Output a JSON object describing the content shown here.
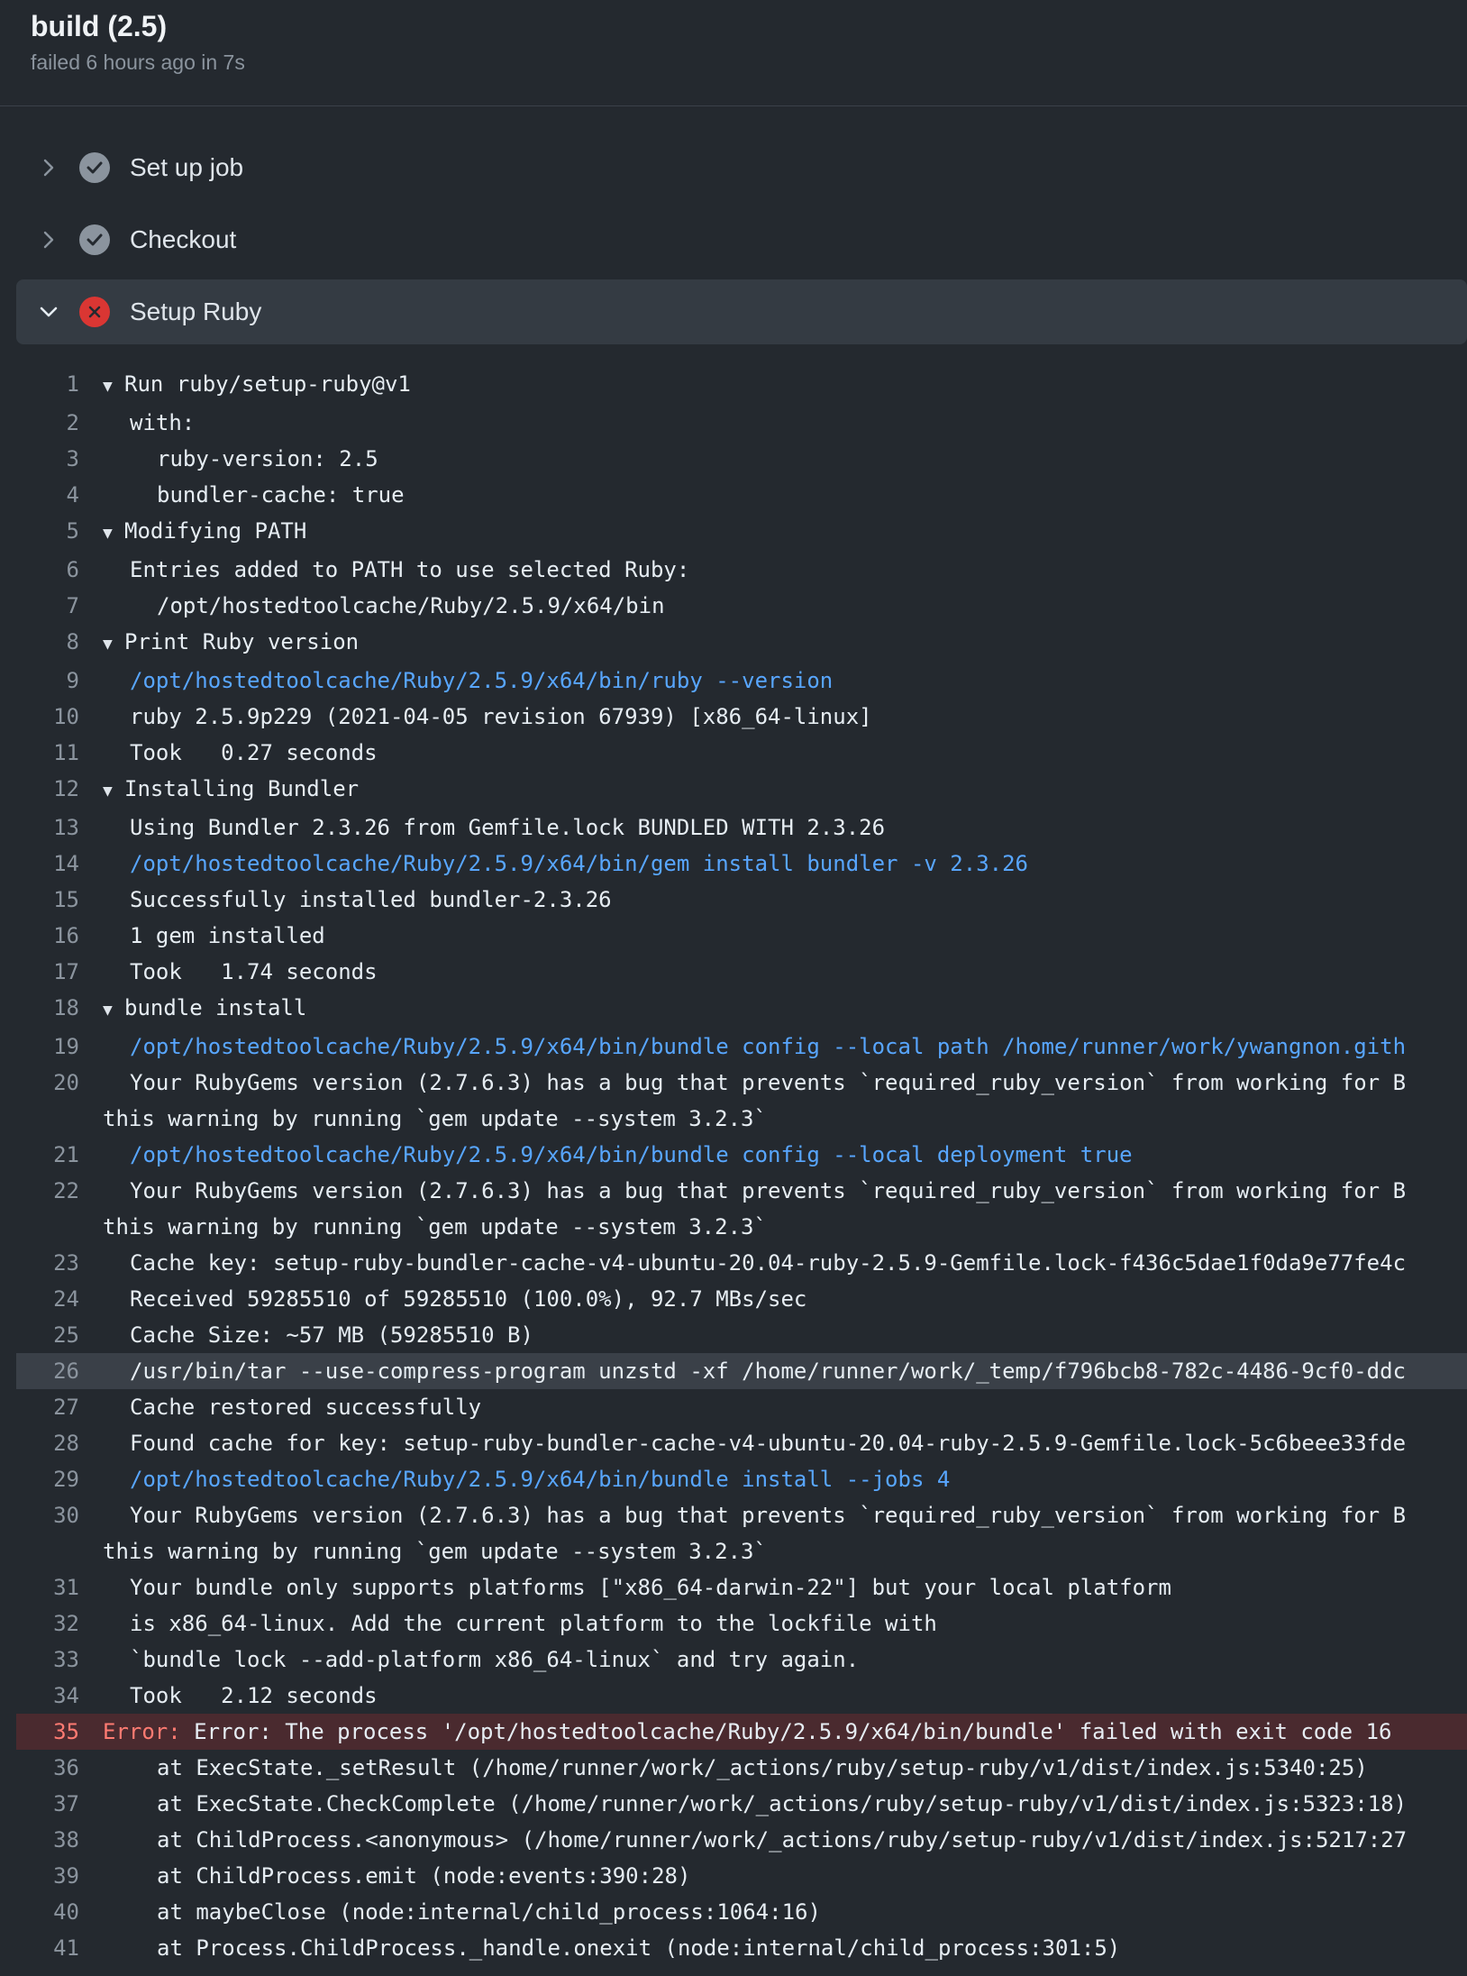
{
  "job": {
    "title": "build (2.5)",
    "subtitle": "failed 6 hours ago in 7s"
  },
  "steps": [
    {
      "label": "Set up job",
      "status": "success",
      "expanded": false
    },
    {
      "label": "Checkout",
      "status": "success",
      "expanded": false
    },
    {
      "label": "Setup Ruby",
      "status": "failure",
      "expanded": true
    }
  ],
  "log": [
    {
      "n": "1",
      "text": "Run ruby/setup-ruby@v1",
      "type": "group"
    },
    {
      "n": "2",
      "text": "with:",
      "type": "i1"
    },
    {
      "n": "3",
      "text": "ruby-version: 2.5",
      "type": "i2"
    },
    {
      "n": "4",
      "text": "bundler-cache: true",
      "type": "i2"
    },
    {
      "n": "5",
      "text": "Modifying PATH",
      "type": "group"
    },
    {
      "n": "6",
      "text": "Entries added to PATH to use selected Ruby:",
      "type": "i1"
    },
    {
      "n": "7",
      "text": "/opt/hostedtoolcache/Ruby/2.5.9/x64/bin",
      "type": "i2"
    },
    {
      "n": "8",
      "text": "Print Ruby version",
      "type": "group"
    },
    {
      "n": "9",
      "text": "/opt/hostedtoolcache/Ruby/2.5.9/x64/bin/ruby --version",
      "type": "cmd"
    },
    {
      "n": "10",
      "text": "ruby 2.5.9p229 (2021-04-05 revision 67939) [x86_64-linux]",
      "type": "i1"
    },
    {
      "n": "11",
      "text": "Took   0.27 seconds",
      "type": "i1"
    },
    {
      "n": "12",
      "text": "Installing Bundler",
      "type": "group"
    },
    {
      "n": "13",
      "text": "Using Bundler 2.3.26 from Gemfile.lock BUNDLED WITH 2.3.26",
      "type": "i1"
    },
    {
      "n": "14",
      "text": "/opt/hostedtoolcache/Ruby/2.5.9/x64/bin/gem install bundler -v 2.3.26",
      "type": "cmd"
    },
    {
      "n": "15",
      "text": "Successfully installed bundler-2.3.26",
      "type": "i1"
    },
    {
      "n": "16",
      "text": "1 gem installed",
      "type": "i1"
    },
    {
      "n": "17",
      "text": "Took   1.74 seconds",
      "type": "i1"
    },
    {
      "n": "18",
      "text": "bundle install",
      "type": "group"
    },
    {
      "n": "19",
      "text": "/opt/hostedtoolcache/Ruby/2.5.9/x64/bin/bundle config --local path /home/runner/work/ywangnon.gith",
      "type": "cmd"
    },
    {
      "n": "20",
      "text": "Your RubyGems version (2.7.6.3) has a bug that prevents `required_ruby_version` from working for B",
      "type": "i1"
    },
    {
      "n": "",
      "text": "this warning by running `gem update --system 3.2.3`",
      "type": "cont"
    },
    {
      "n": "21",
      "text": "/opt/hostedtoolcache/Ruby/2.5.9/x64/bin/bundle config --local deployment true",
      "type": "cmd"
    },
    {
      "n": "22",
      "text": "Your RubyGems version (2.7.6.3) has a bug that prevents `required_ruby_version` from working for B",
      "type": "i1"
    },
    {
      "n": "",
      "text": "this warning by running `gem update --system 3.2.3`",
      "type": "cont"
    },
    {
      "n": "23",
      "text": "Cache key: setup-ruby-bundler-cache-v4-ubuntu-20.04-ruby-2.5.9-Gemfile.lock-f436c5dae1f0da9e77fe4c",
      "type": "i1"
    },
    {
      "n": "24",
      "text": "Received 59285510 of 59285510 (100.0%), 92.7 MBs/sec",
      "type": "i1"
    },
    {
      "n": "25",
      "text": "Cache Size: ~57 MB (59285510 B)",
      "type": "i1"
    },
    {
      "n": "26",
      "text": "/usr/bin/tar --use-compress-program unzstd -xf /home/runner/work/_temp/f796bcb8-782c-4486-9cf0-ddc",
      "type": "i1",
      "highlight": true
    },
    {
      "n": "27",
      "text": "Cache restored successfully",
      "type": "i1"
    },
    {
      "n": "28",
      "text": "Found cache for key: setup-ruby-bundler-cache-v4-ubuntu-20.04-ruby-2.5.9-Gemfile.lock-5c6beee33fde",
      "type": "i1"
    },
    {
      "n": "29",
      "text": "/opt/hostedtoolcache/Ruby/2.5.9/x64/bin/bundle install --jobs 4",
      "type": "cmd"
    },
    {
      "n": "30",
      "text": "Your RubyGems version (2.7.6.3) has a bug that prevents `required_ruby_version` from working for B",
      "type": "i1"
    },
    {
      "n": "",
      "text": "this warning by running `gem update --system 3.2.3`",
      "type": "cont"
    },
    {
      "n": "31",
      "text": "Your bundle only supports platforms [\"x86_64-darwin-22\"] but your local platform",
      "type": "i1"
    },
    {
      "n": "32",
      "text": "is x86_64-linux. Add the current platform to the lockfile with",
      "type": "i1"
    },
    {
      "n": "33",
      "text": "`bundle lock --add-platform x86_64-linux` and try again.",
      "type": "i1"
    },
    {
      "n": "34",
      "text": "Took   2.12 seconds",
      "type": "i1"
    },
    {
      "n": "35",
      "label": "Error:",
      "text": " Error: The process '/opt/hostedtoolcache/Ruby/2.5.9/x64/bin/bundle' failed with exit code 16",
      "type": "error"
    },
    {
      "n": "36",
      "text": "at ExecState._setResult (/home/runner/work/_actions/ruby/setup-ruby/v1/dist/index.js:5340:25)",
      "type": "trace"
    },
    {
      "n": "37",
      "text": "at ExecState.CheckComplete (/home/runner/work/_actions/ruby/setup-ruby/v1/dist/index.js:5323:18)",
      "type": "trace"
    },
    {
      "n": "38",
      "text": "at ChildProcess.<anonymous> (/home/runner/work/_actions/ruby/setup-ruby/v1/dist/index.js:5217:27",
      "type": "trace"
    },
    {
      "n": "39",
      "text": "at ChildProcess.emit (node:events:390:28)",
      "type": "trace"
    },
    {
      "n": "40",
      "text": "at maybeClose (node:internal/child_process:1064:16)",
      "type": "trace"
    },
    {
      "n": "41",
      "text": "at Process.ChildProcess._handle.onexit (node:internal/child_process:301:5)",
      "type": "trace"
    }
  ]
}
